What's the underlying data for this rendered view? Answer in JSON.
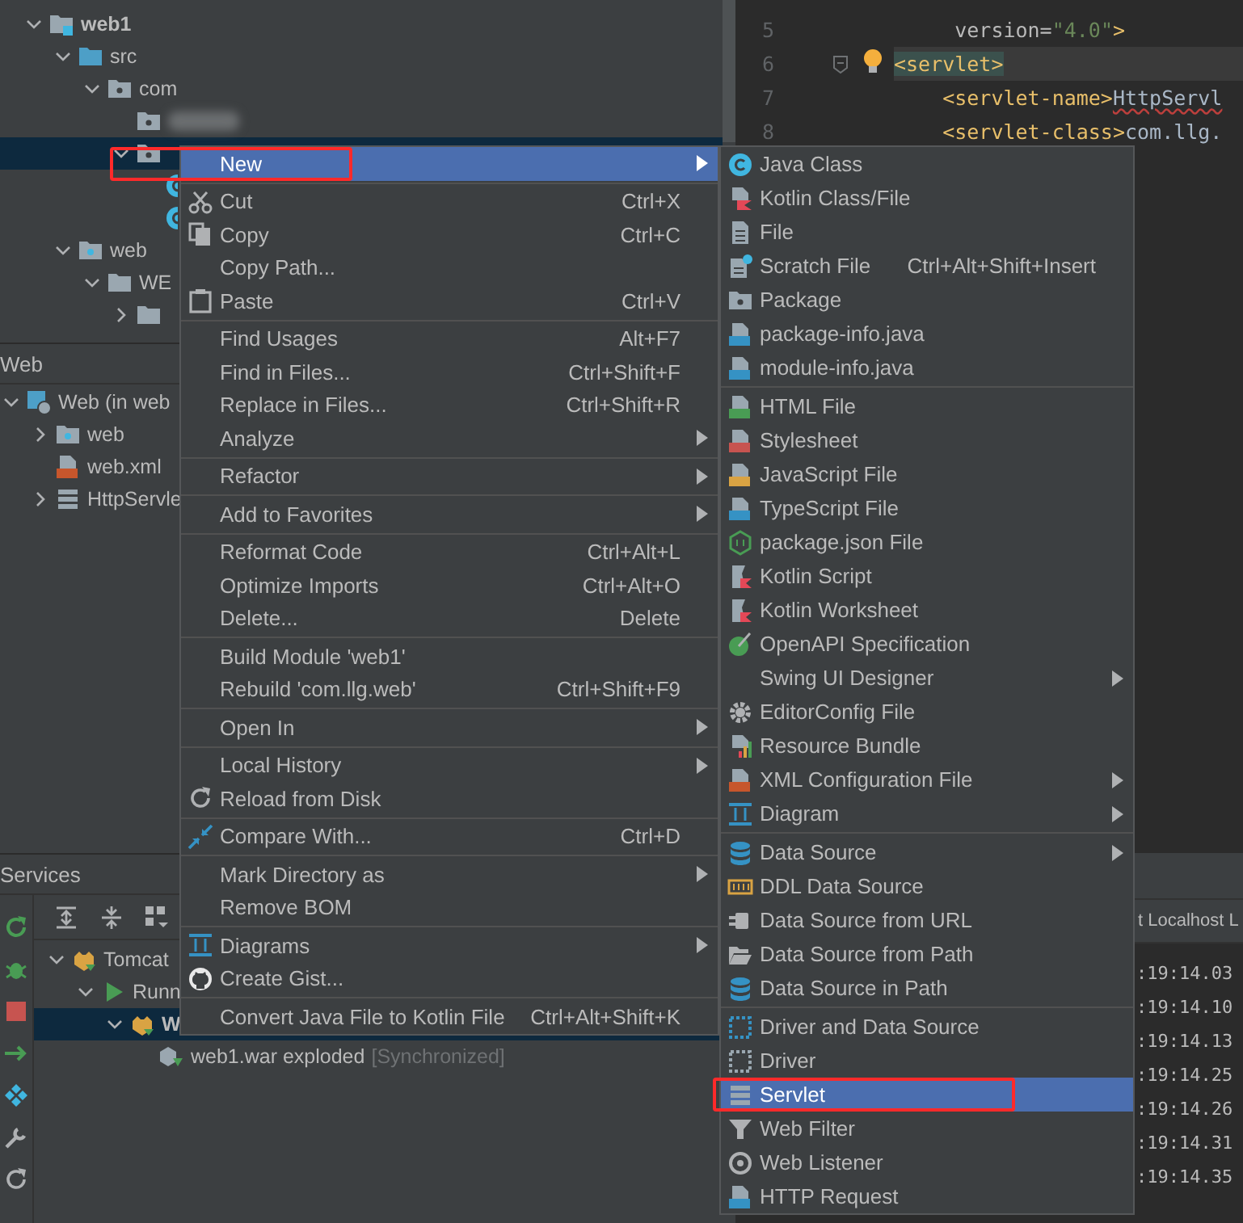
{
  "project_tree": {
    "items": [
      {
        "label": "web1",
        "kind": "module",
        "bold": true,
        "expanded": true,
        "selected": false,
        "children": [
          {
            "label": "src",
            "kind": "source-folder",
            "expanded": true,
            "selected": false,
            "children": [
              {
                "label": "com",
                "kind": "package",
                "expanded": true,
                "selected": false,
                "children": [
                  {
                    "kind": "package",
                    "blurred": true,
                    "selected": false
                  },
                  {
                    "kind": "package",
                    "blurred": false,
                    "expanded": true,
                    "selected": true,
                    "children": [
                      {
                        "kind": "class-cut",
                        "selected": false
                      },
                      {
                        "kind": "class-cut",
                        "selected": false
                      }
                    ]
                  }
                ]
              }
            ]
          },
          {
            "label": "web",
            "kind": "web-folder",
            "expanded": true,
            "selected": false,
            "children": [
              {
                "label": "WE",
                "kind": "folder",
                "expanded": true,
                "selected": false,
                "children": [
                  {
                    "kind": "folder",
                    "expanded": false,
                    "selected": false
                  }
                ]
              }
            ]
          }
        ]
      }
    ]
  },
  "web_panel": {
    "title": "Web",
    "items": [
      {
        "label": "Web (in web",
        "kind": "web-facet",
        "expanded": true,
        "selected": false,
        "children": [
          {
            "label": "web",
            "kind": "web-folder",
            "expanded": false,
            "selected": false
          },
          {
            "label": "web.xml",
            "kind": "xml-file",
            "selected": false
          },
          {
            "label": "HttpServle",
            "kind": "servlet",
            "expanded": false,
            "selected": false
          }
        ]
      }
    ]
  },
  "services": {
    "title": "Services",
    "items": [
      {
        "label": "Tomcat",
        "kind": "tomcat",
        "expanded": true,
        "selected": false,
        "children": [
          {
            "label": "Runn",
            "kind": "run",
            "expanded": true,
            "selected": false,
            "children": [
              {
                "label": "W",
                "kind": "tomcat",
                "bold": true,
                "expanded": true,
                "selected": true,
                "children": [
                  {
                    "label": "web1.war exploded",
                    "status": "[Synchronized]",
                    "kind": "artifact",
                    "selected": false
                  }
                ]
              }
            ]
          }
        ]
      }
    ]
  },
  "editor": {
    "lines": [
      {
        "number": "5",
        "current": false,
        "fold": false,
        "hint": false,
        "tokens": [
          {
            "kind": "attr",
            "text": "     version="
          },
          {
            "kind": "value",
            "text": "\"4.0\""
          },
          {
            "kind": "tag",
            "text": ">"
          }
        ]
      },
      {
        "number": "6",
        "current": true,
        "fold": true,
        "hint": true,
        "tokens": [
          {
            "kind": "tag-matched",
            "text": "<servlet>"
          }
        ]
      },
      {
        "number": "7",
        "current": false,
        "fold": false,
        "hint": false,
        "tokens": [
          {
            "kind": "tag",
            "text": "    <servlet-name>"
          },
          {
            "kind": "text-error",
            "text": "HttpServl"
          }
        ]
      },
      {
        "number": "8",
        "current": false,
        "fold": false,
        "hint": false,
        "tokens": [
          {
            "kind": "tag",
            "text": "    <servlet-class>"
          },
          {
            "kind": "text",
            "text": "com.llg."
          }
        ]
      }
    ]
  },
  "log": {
    "tab": "t Localhost L",
    "lines": [
      ":19:14.03",
      ":19:14.10",
      ":19:14.13",
      ":19:14.25",
      ":19:14.26",
      ":19:14.31",
      ":19:14.35"
    ]
  },
  "context_menu": {
    "groups": [
      {
        "items": [
          {
            "label": "New",
            "kind": "plain",
            "submenu": true,
            "selected": true,
            "callout": true
          }
        ]
      },
      {
        "items": [
          {
            "label": "Cut",
            "kind": "scissors",
            "shortcut": "Ctrl+X",
            "submenu": false,
            "selected": false,
            "callout": false
          },
          {
            "label": "Copy",
            "kind": "copy",
            "shortcut": "Ctrl+C",
            "submenu": false,
            "selected": false,
            "callout": false
          },
          {
            "label": "Copy Path...",
            "kind": "plain",
            "submenu": false,
            "selected": false,
            "callout": false
          },
          {
            "label": "Paste",
            "kind": "clipboard",
            "shortcut": "Ctrl+V",
            "submenu": false,
            "selected": false,
            "callout": false
          }
        ]
      },
      {
        "items": [
          {
            "label": "Find Usages",
            "kind": "plain",
            "shortcut": "Alt+F7",
            "submenu": false,
            "selected": false,
            "callout": false
          },
          {
            "label": "Find in Files...",
            "kind": "plain",
            "shortcut": "Ctrl+Shift+F",
            "submenu": false,
            "selected": false,
            "callout": false
          },
          {
            "label": "Replace in Files...",
            "kind": "plain",
            "shortcut": "Ctrl+Shift+R",
            "submenu": false,
            "selected": false,
            "callout": false
          },
          {
            "label": "Analyze",
            "kind": "plain",
            "submenu": true,
            "selected": false,
            "callout": false
          }
        ]
      },
      {
        "items": [
          {
            "label": "Refactor",
            "kind": "plain",
            "submenu": true,
            "selected": false,
            "callout": false
          }
        ]
      },
      {
        "items": [
          {
            "label": "Add to Favorites",
            "kind": "plain",
            "submenu": true,
            "selected": false,
            "callout": false
          }
        ]
      },
      {
        "items": [
          {
            "label": "Reformat Code",
            "kind": "plain",
            "shortcut": "Ctrl+Alt+L",
            "submenu": false,
            "selected": false,
            "callout": false
          },
          {
            "label": "Optimize Imports",
            "kind": "plain",
            "shortcut": "Ctrl+Alt+O",
            "submenu": false,
            "selected": false,
            "callout": false
          },
          {
            "label": "Delete...",
            "kind": "plain",
            "shortcut": "Delete",
            "submenu": false,
            "selected": false,
            "callout": false
          }
        ]
      },
      {
        "items": [
          {
            "label": "Build Module 'web1'",
            "kind": "plain",
            "submenu": false,
            "selected": false,
            "callout": false
          },
          {
            "label": "Rebuild 'com.llg.web'",
            "kind": "plain",
            "shortcut": "Ctrl+Shift+F9",
            "submenu": false,
            "selected": false,
            "callout": false
          }
        ]
      },
      {
        "items": [
          {
            "label": "Open In",
            "kind": "plain",
            "submenu": true,
            "selected": false,
            "callout": false
          }
        ]
      },
      {
        "items": [
          {
            "label": "Local History",
            "kind": "plain",
            "submenu": true,
            "selected": false,
            "callout": false
          },
          {
            "label": "Reload from Disk",
            "kind": "reload",
            "submenu": false,
            "selected": false,
            "callout": false
          }
        ]
      },
      {
        "items": [
          {
            "label": "Compare With...",
            "kind": "compare",
            "shortcut": "Ctrl+D",
            "submenu": false,
            "selected": false,
            "callout": false
          }
        ]
      },
      {
        "items": [
          {
            "label": "Mark Directory as",
            "kind": "plain",
            "submenu": true,
            "selected": false,
            "callout": false
          },
          {
            "label": "Remove BOM",
            "kind": "plain",
            "submenu": false,
            "selected": false,
            "callout": false
          }
        ]
      },
      {
        "items": [
          {
            "label": "Diagrams",
            "kind": "diagram",
            "submenu": true,
            "selected": false,
            "callout": false
          },
          {
            "label": "Create Gist...",
            "kind": "github",
            "submenu": false,
            "selected": false,
            "callout": false
          }
        ]
      },
      {
        "items": [
          {
            "label": "Convert Java File to Kotlin File",
            "kind": "plain",
            "shortcut": "Ctrl+Alt+Shift+K",
            "submenu": false,
            "selected": false,
            "callout": false
          }
        ]
      }
    ]
  },
  "new_submenu": {
    "groups": [
      {
        "items": [
          {
            "label": "Java Class",
            "kind": "class",
            "submenu": false,
            "selected": false,
            "callout": false
          },
          {
            "label": "Kotlin Class/File",
            "kind": "kotlin-file",
            "submenu": false,
            "selected": false,
            "callout": false
          },
          {
            "label": "File",
            "kind": "file",
            "submenu": false,
            "selected": false,
            "callout": false
          },
          {
            "label": "Scratch File",
            "kind": "scratch-file",
            "shortcut": "Ctrl+Alt+Shift+Insert",
            "submenu": false,
            "selected": false,
            "callout": false
          },
          {
            "label": "Package",
            "kind": "package",
            "submenu": false,
            "selected": false,
            "callout": false
          },
          {
            "label": "package-info.java",
            "kind": "java-file",
            "submenu": false,
            "selected": false,
            "callout": false
          },
          {
            "label": "module-info.java",
            "kind": "java-file",
            "submenu": false,
            "selected": false,
            "callout": false
          }
        ]
      },
      {
        "items": [
          {
            "label": "HTML File",
            "kind": "html",
            "submenu": false,
            "selected": false,
            "callout": false
          },
          {
            "label": "Stylesheet",
            "kind": "css",
            "submenu": false,
            "selected": false,
            "callout": false
          },
          {
            "label": "JavaScript File",
            "kind": "js",
            "submenu": false,
            "selected": false,
            "callout": false
          },
          {
            "label": "TypeScript File",
            "kind": "ts",
            "submenu": false,
            "selected": false,
            "callout": false
          },
          {
            "label": "package.json File",
            "kind": "nodejs",
            "submenu": false,
            "selected": false,
            "callout": false
          },
          {
            "label": "Kotlin Script",
            "kind": "kotlin-script",
            "submenu": false,
            "selected": false,
            "callout": false
          },
          {
            "label": "Kotlin Worksheet",
            "kind": "kotlin-script",
            "submenu": false,
            "selected": false,
            "callout": false
          },
          {
            "label": "OpenAPI Specification",
            "kind": "openapi",
            "submenu": false,
            "selected": false,
            "callout": false
          },
          {
            "label": "Swing UI Designer",
            "kind": "plain",
            "submenu": true,
            "selected": false,
            "callout": false
          },
          {
            "label": "EditorConfig File",
            "kind": "gear",
            "submenu": false,
            "selected": false,
            "callout": false
          },
          {
            "label": "Resource Bundle",
            "kind": "resource-bundle",
            "submenu": false,
            "selected": false,
            "callout": false
          },
          {
            "label": "XML Configuration File",
            "kind": "xml-file",
            "submenu": true,
            "selected": false,
            "callout": false
          },
          {
            "label": "Diagram",
            "kind": "diagram",
            "submenu": true,
            "selected": false,
            "callout": false
          }
        ]
      },
      {
        "items": [
          {
            "label": "Data Source",
            "kind": "database",
            "submenu": true,
            "selected": false,
            "callout": false
          },
          {
            "label": "DDL Data Source",
            "kind": "ddl",
            "submenu": false,
            "selected": false,
            "callout": false
          },
          {
            "label": "Data Source from URL",
            "kind": "plug",
            "submenu": false,
            "selected": false,
            "callout": false
          },
          {
            "label": "Data Source from Path",
            "kind": "open-folder",
            "submenu": false,
            "selected": false,
            "callout": false
          },
          {
            "label": "Data Source in Path",
            "kind": "database",
            "submenu": false,
            "selected": false,
            "callout": false
          }
        ]
      },
      {
        "items": [
          {
            "label": "Driver and Data Source",
            "kind": "driver-data-source",
            "submenu": false,
            "selected": false,
            "callout": false
          },
          {
            "label": "Driver",
            "kind": "driver",
            "submenu": false,
            "selected": false,
            "callout": false
          },
          {
            "label": "Servlet",
            "kind": "servlet",
            "submenu": false,
            "selected": true,
            "callout": true
          },
          {
            "label": "Web Filter",
            "kind": "filter",
            "submenu": false,
            "selected": false,
            "callout": false
          },
          {
            "label": "Web Listener",
            "kind": "listener",
            "submenu": false,
            "selected": false,
            "callout": false
          },
          {
            "label": "HTTP Request",
            "kind": "api",
            "submenu": false,
            "selected": false,
            "callout": false
          }
        ]
      }
    ]
  }
}
